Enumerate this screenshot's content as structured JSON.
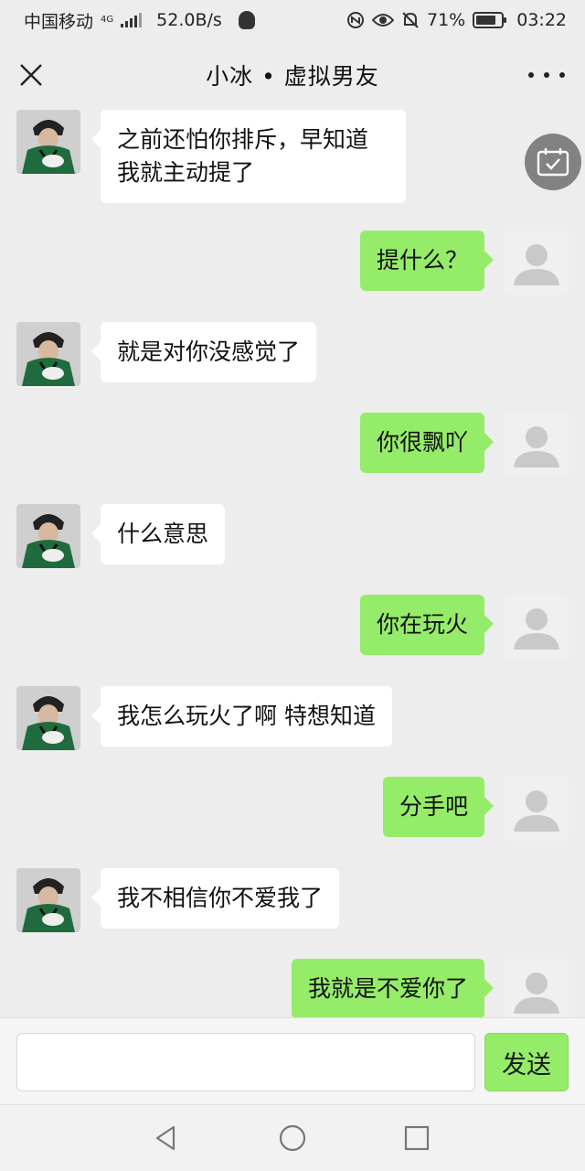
{
  "status": {
    "carrier": "中国移动",
    "network": "4G",
    "speed": "52.0B/s",
    "battery_pct": "71%",
    "time": "03:22",
    "icons": [
      "signal-icon",
      "qq-icon",
      "nfc-icon",
      "eye-icon",
      "mute-icon",
      "battery-icon"
    ]
  },
  "header": {
    "title": "小冰 • 虚拟男友"
  },
  "messages": [
    {
      "side": "left",
      "text": "之前还怕你排斥，早知道我就主动提了"
    },
    {
      "side": "right",
      "text": "提什么？"
    },
    {
      "side": "left",
      "text": "就是对你没感觉了"
    },
    {
      "side": "right",
      "text": "你很飘吖"
    },
    {
      "side": "left",
      "text": "什么意思"
    },
    {
      "side": "right",
      "text": "你在玩火"
    },
    {
      "side": "left",
      "text": "我怎么玩火了啊 特想知道"
    },
    {
      "side": "right",
      "text": "分手吧"
    },
    {
      "side": "left",
      "text": "我不相信你不爱我了"
    },
    {
      "side": "right",
      "text": "我就是不爱你了"
    }
  ],
  "composer": {
    "input_value": "",
    "send_label": "发送"
  },
  "colors": {
    "background": "#ededed",
    "bubble_self": "#95ec69",
    "bubble_other": "#ffffff"
  }
}
